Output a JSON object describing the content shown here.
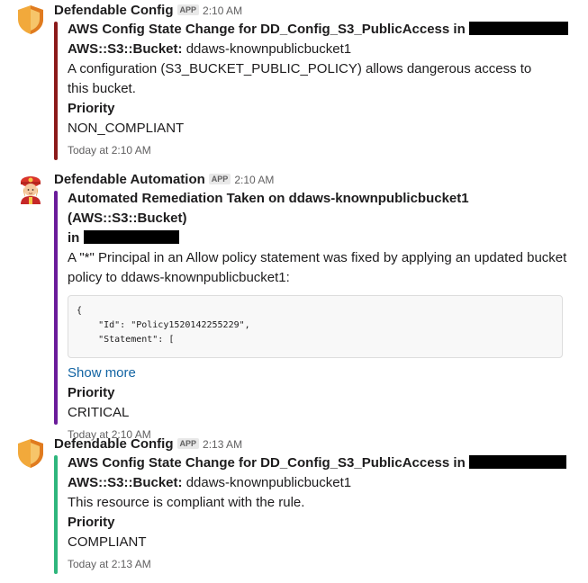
{
  "messages": [
    {
      "sender": "Defendable Config",
      "badge": "APP",
      "time": "2:10 AM",
      "accent": "#8b1a1a",
      "title": "AWS Config State Change for DD_Config_S3_PublicAccess in",
      "resource_label": "AWS::S3::Bucket:",
      "resource_value": "ddaws-knownpublicbucket1",
      "description": "A configuration (S3_BUCKET_PUBLIC_POLICY) allows dangerous access to this bucket.",
      "priority_label": "Priority",
      "priority_value": "NON_COMPLIANT",
      "footer": "Today at 2:10 AM"
    },
    {
      "sender": "Defendable Automation",
      "badge": "APP",
      "time": "2:10 AM",
      "accent": "#6a1b9a",
      "title": "Automated Remediation Taken on ddaws-knownpublicbucket1 (AWS::S3::Bucket)",
      "title_suffix": "in",
      "description": "A \"*\" Principal in an Allow policy statement was fixed by applying an updated bucket policy to ddaws-knownpublicbucket1:",
      "code": "{\n    \"Id\": \"Policy1520142255229\",\n    \"Statement\": [",
      "show_more": "Show more",
      "priority_label": "Priority",
      "priority_value": "CRITICAL",
      "footer": "Today at 2:10 AM"
    },
    {
      "sender": "Defendable Config",
      "badge": "APP",
      "time": "2:13 AM",
      "accent": "#2eb67d",
      "title": "AWS Config State Change for DD_Config_S3_PublicAccess in",
      "resource_label": "AWS::S3::Bucket:",
      "resource_value": "ddaws-knownpublicbucket1",
      "description": "This resource is compliant with the rule.",
      "priority_label": "Priority",
      "priority_value": "COMPLIANT",
      "footer": "Today at 2:13 AM"
    }
  ],
  "icons": {
    "config_avatar": "shield-icon",
    "automation_avatar": "firefighter-icon"
  }
}
